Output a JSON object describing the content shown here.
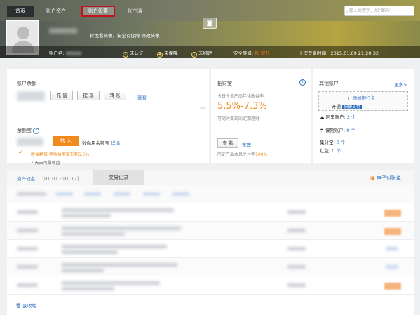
{
  "nav": {
    "items": [
      "首页",
      "账户资产",
      "账户设置",
      "账户通"
    ],
    "search_placeholder": "输入关键字，如“密码”"
  },
  "header": {
    "avatar_tip": "转换看头像，安全有保障  修改头像",
    "account_label": "账户名:",
    "status": [
      "未认证",
      "未保障",
      "未绑定"
    ],
    "security_label": "安全等级:",
    "security_value": "低",
    "security_link": "提升",
    "last_login": "上次登录时间：2015.01.09 21:20:32"
  },
  "balance": {
    "title": "账户余额",
    "buttons": [
      "充 值",
      "提 现",
      "转 账"
    ],
    "view_link": "查看"
  },
  "yuebao": {
    "title": "余额宝",
    "transfer_in": "转 入",
    "tip": "数你用余额宝",
    "detail_link": "详情",
    "promo": "收益翻倍 年收益率提升到5.5%",
    "promo_sub": "天天可赚收益"
  },
  "zhaocaibao": {
    "title": "招财宝",
    "sub": "今日主推产品年化收益率:",
    "rate": "5.5%-7.3%",
    "note": "可随时变现的定期理财",
    "view_btn": "查 看",
    "manage_link": "管理",
    "history": "历史产品本息兑付率",
    "history_rate": "100%"
  },
  "other": {
    "title": "其他账户",
    "more_link": "更多>",
    "add_card": "+ 添加银行卡",
    "open_label": "开通",
    "quick_pay": "快捷支付",
    "items": [
      {
        "label": "阿里账户:",
        "value": "2 个"
      },
      {
        "label": "保险账户:",
        "value": "0 个"
      },
      {
        "label": "集分宝:",
        "value": "0 个"
      },
      {
        "label": "红包:",
        "value": "0 个"
      }
    ]
  },
  "records": {
    "tab_dynamic": "资产动态",
    "date_range": "(01.01 - 01.12)",
    "tab_trade": "交易记录",
    "e_bill": "电子对账单",
    "recycle": "回收站"
  },
  "colors": {
    "accent": "#f08a1c",
    "link": "#2a6dbf",
    "highlight_border": "#c4121a"
  }
}
